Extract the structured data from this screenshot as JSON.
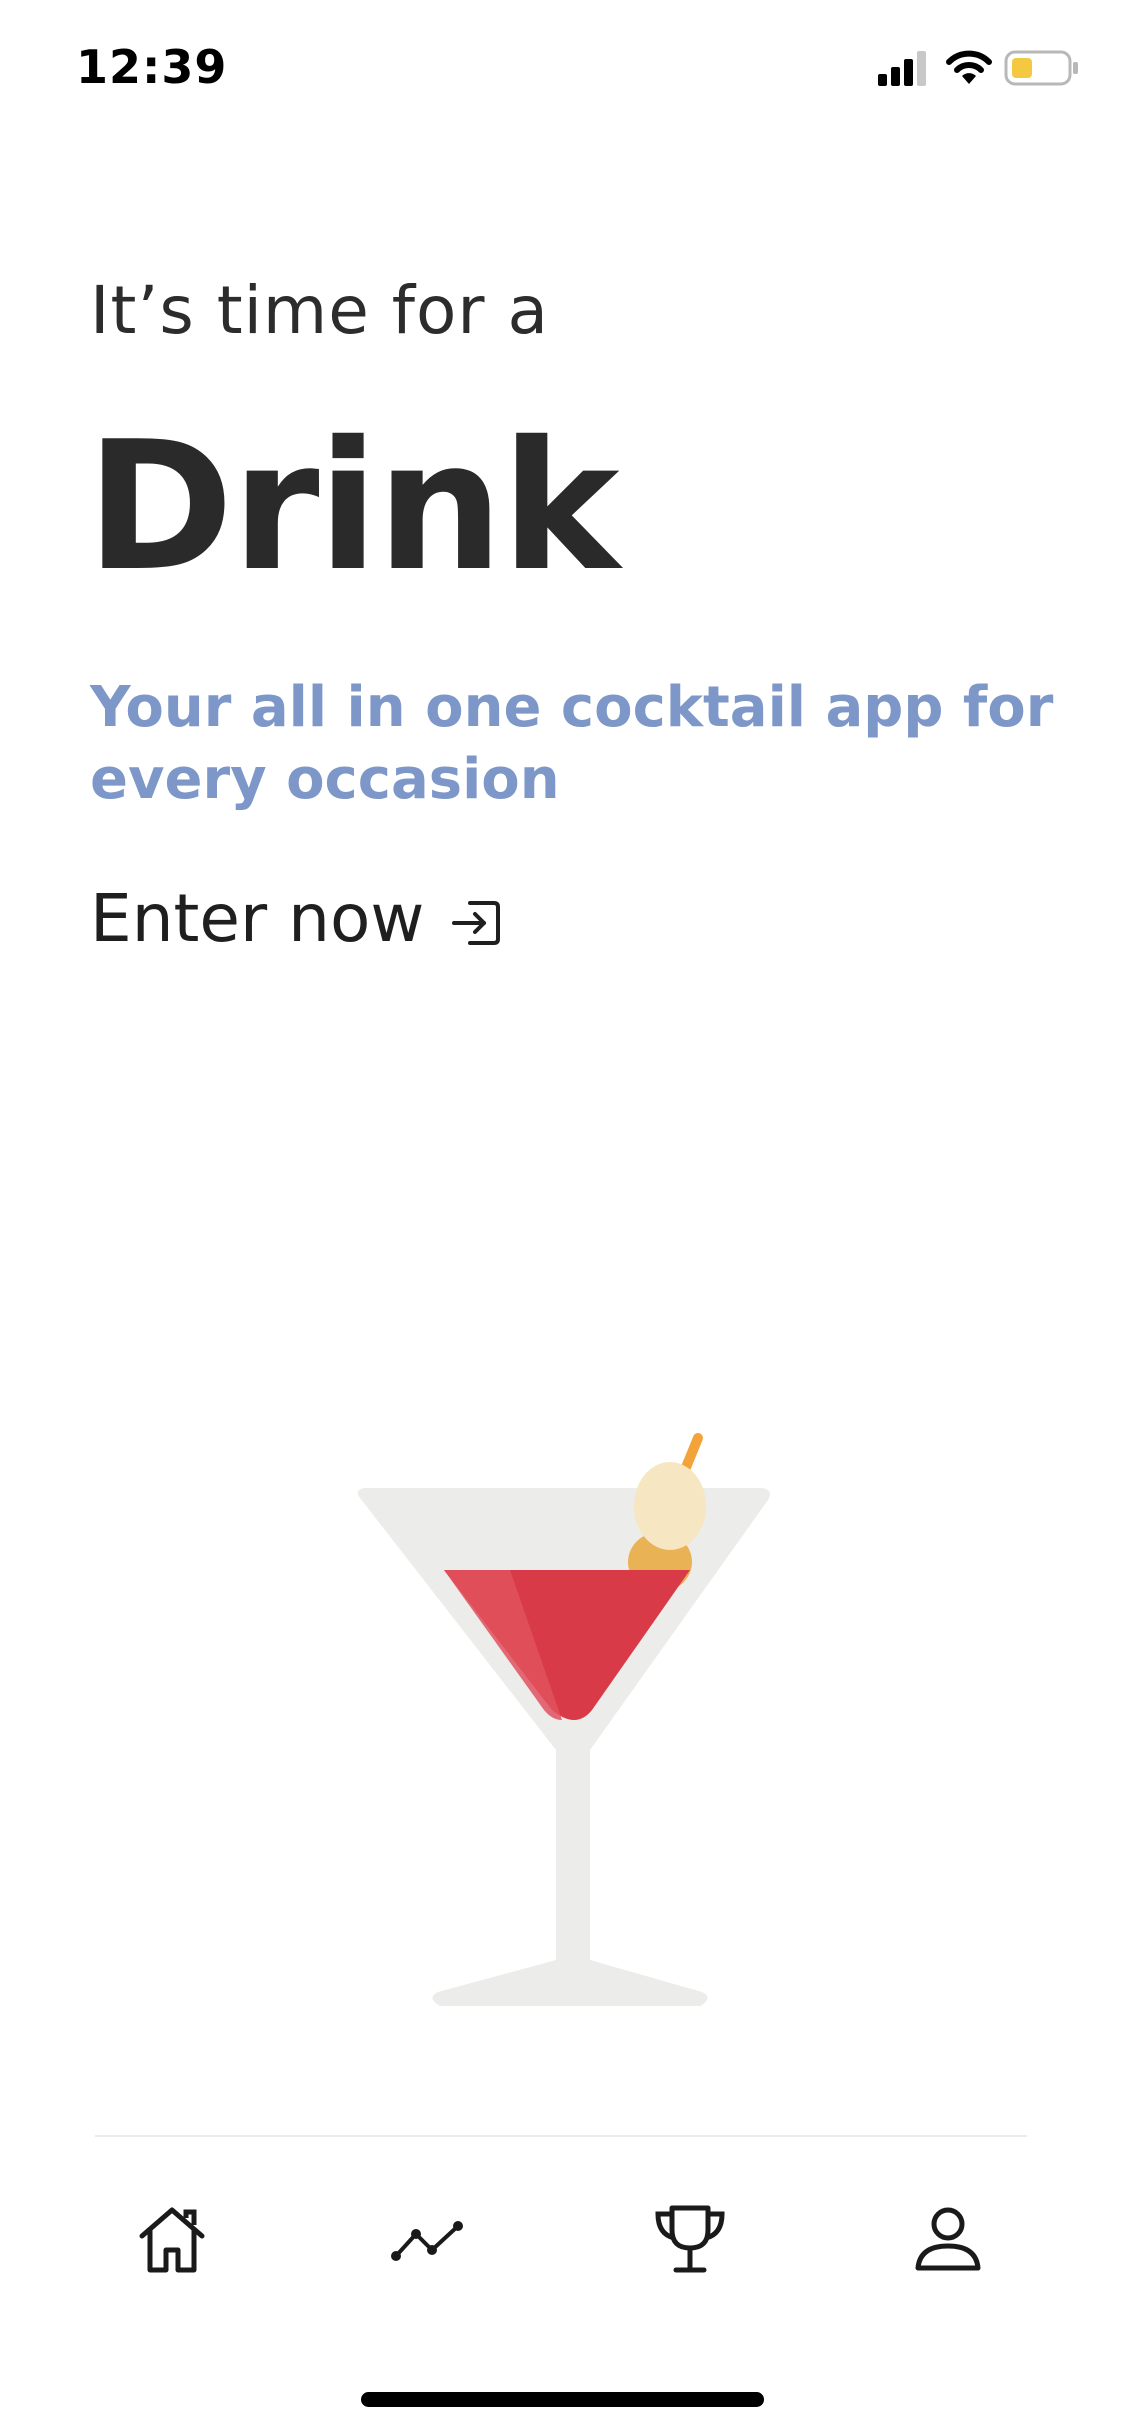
{
  "status_bar": {
    "time": "12:39",
    "icons": [
      "cellular-signal-icon",
      "wifi-icon",
      "battery-icon"
    ],
    "battery_color": "#f5c842"
  },
  "hero": {
    "pre_title": "It’s time for a",
    "title": "Drink",
    "tagline": "Your all in one cocktail app for every occasion",
    "enter_label": "Enter now",
    "enter_icon": "enter-arrow-icon",
    "tagline_color": "#7d97c9"
  },
  "illustration": {
    "name": "martini-glass",
    "colors": {
      "glass": "#ececea",
      "drink": "#d93a47",
      "olive": "#e9b254",
      "olive_light": "#f6e6c2",
      "pick": "#f2a43a"
    }
  },
  "bottom_nav": {
    "items": [
      {
        "icon": "home-icon"
      },
      {
        "icon": "trend-chart-icon"
      },
      {
        "icon": "trophy-icon"
      },
      {
        "icon": "profile-icon"
      }
    ]
  }
}
